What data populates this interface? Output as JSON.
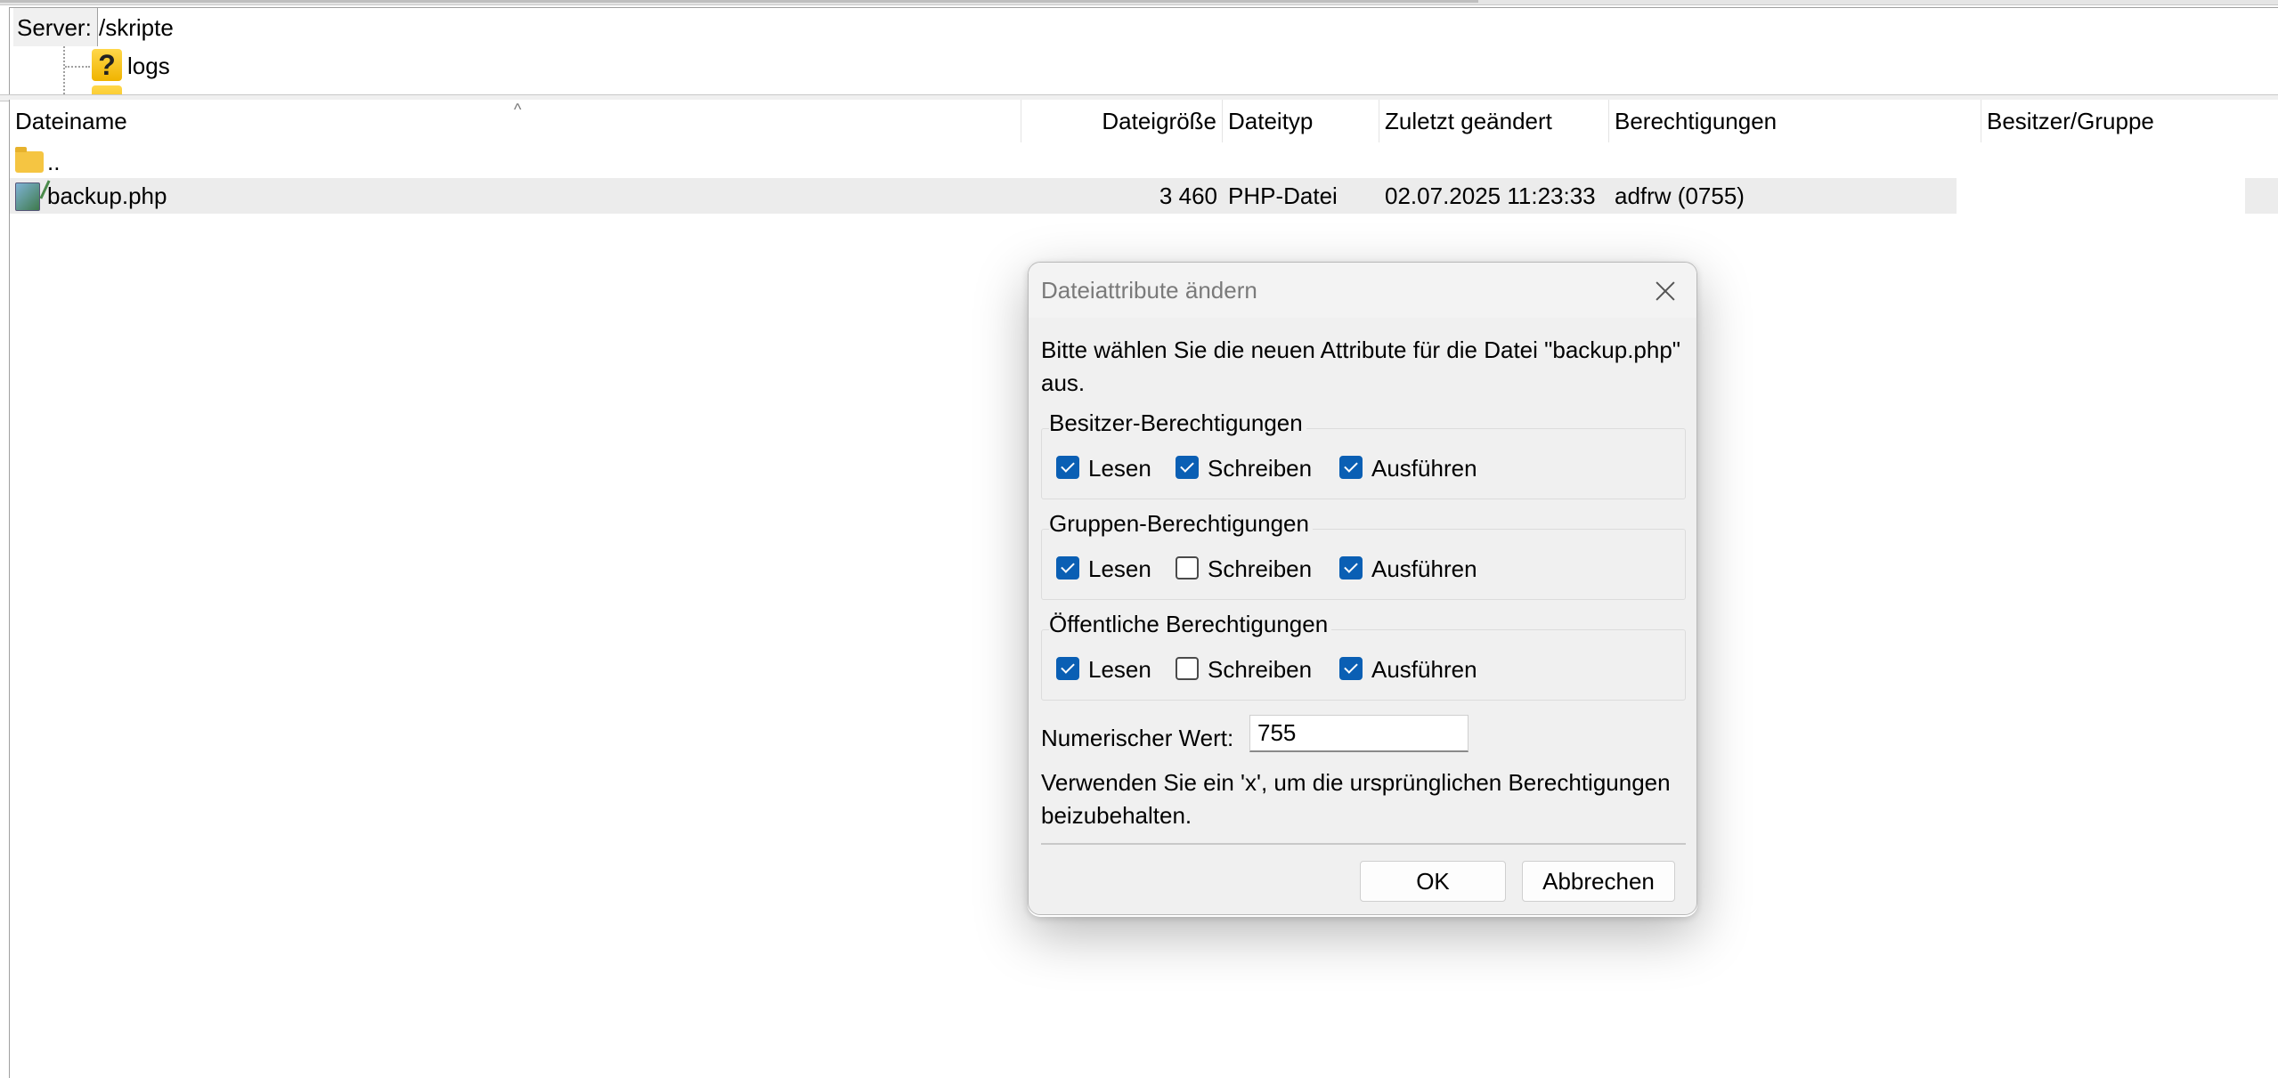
{
  "server_bar": {
    "label": "Server:",
    "path": "/skripte"
  },
  "tree": {
    "items": [
      {
        "label": "logs",
        "icon": "question-folder-icon"
      }
    ]
  },
  "file_list": {
    "columns": [
      {
        "label": "Dateiname"
      },
      {
        "label": "Dateigröße"
      },
      {
        "label": "Dateityp"
      },
      {
        "label": "Zuletzt geändert"
      },
      {
        "label": "Berechtigungen"
      },
      {
        "label": "Besitzer/Gruppe"
      }
    ],
    "sort_indicator": "^",
    "rows": [
      {
        "name": "..",
        "size": "",
        "type": "",
        "modified": "",
        "permissions": "",
        "owner": "",
        "icon": "folder-icon"
      },
      {
        "name": "backup.php",
        "size": "3 460",
        "type": "PHP-Datei",
        "modified": "02.07.2025 11:23:33",
        "permissions": "adfrw (0755)",
        "owner": "",
        "icon": "php-file-icon"
      }
    ]
  },
  "dialog": {
    "title": "Dateiattribute ändern",
    "description": "Bitte wählen Sie die neuen Attribute für die Datei \"backup.php\" aus.",
    "groups": [
      {
        "title": "Besitzer-Berechtigungen",
        "options": [
          {
            "label": "Lesen",
            "checked": true
          },
          {
            "label": "Schreiben",
            "checked": true
          },
          {
            "label": "Ausführen",
            "checked": true
          }
        ]
      },
      {
        "title": "Gruppen-Berechtigungen",
        "options": [
          {
            "label": "Lesen",
            "checked": true
          },
          {
            "label": "Schreiben",
            "checked": false
          },
          {
            "label": "Ausführen",
            "checked": true
          }
        ]
      },
      {
        "title": "Öffentliche Berechtigungen",
        "options": [
          {
            "label": "Lesen",
            "checked": true
          },
          {
            "label": "Schreiben",
            "checked": false
          },
          {
            "label": "Ausführen",
            "checked": true
          }
        ]
      }
    ],
    "numeric_label": "Numerischer Wert:",
    "numeric_value": "755",
    "hint": "Verwenden Sie ein 'x', um die ursprünglichen Berechtigungen beizubehalten.",
    "ok_label": "OK",
    "cancel_label": "Abbrechen"
  },
  "colors": {
    "checkbox_accent": "#0a5fb4",
    "selected_row": "#ececec",
    "dialog_bg": "#f0f0f0"
  }
}
